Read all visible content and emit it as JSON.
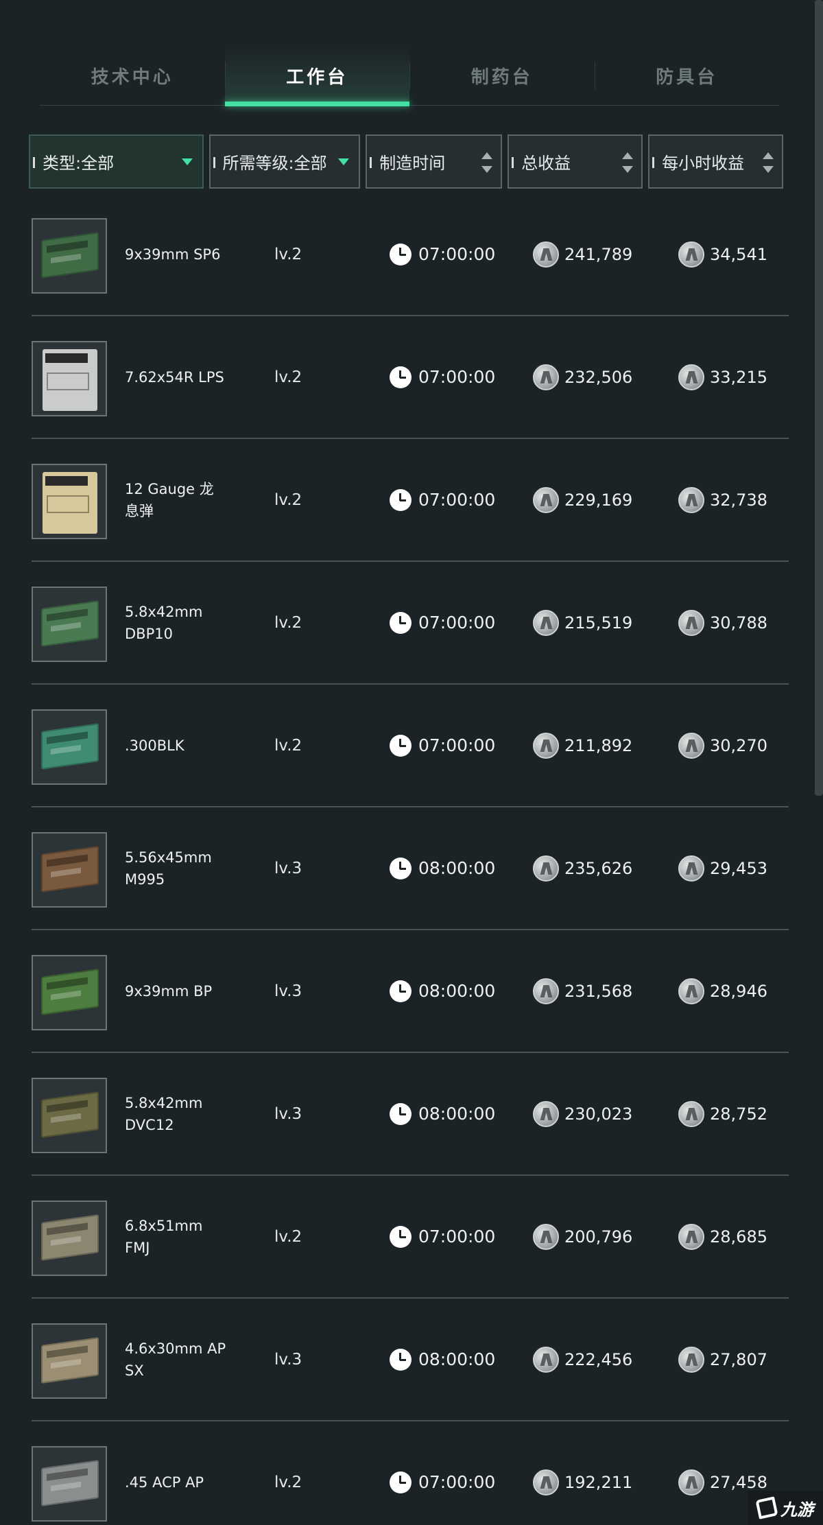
{
  "tabs": [
    {
      "label": "技术中心",
      "active": false
    },
    {
      "label": "工作台",
      "active": true
    },
    {
      "label": "制药台",
      "active": false
    },
    {
      "label": "防具台",
      "active": false
    }
  ],
  "filters": {
    "type": "类型:全部",
    "level": "所需等级:全部",
    "craft_time": "制造时间",
    "total_profit": "总收益",
    "hourly_profit": "每小时收益"
  },
  "items": [
    {
      "name": "9x39mm SP6",
      "level": "lv.2",
      "time": "07:00:00",
      "total": "241,789",
      "hourly": "34,541",
      "color": "#3f6b45"
    },
    {
      "name": "7.62x54R LPS",
      "level": "lv.2",
      "time": "07:00:00",
      "total": "232,506",
      "hourly": "33,215",
      "color": "#c9cccb"
    },
    {
      "name": "12 Gauge 龙息弹",
      "level": "lv.2",
      "time": "07:00:00",
      "total": "229,169",
      "hourly": "32,738",
      "color": "#d6c89a"
    },
    {
      "name": "5.8x42mm DBP10",
      "level": "lv.2",
      "time": "07:00:00",
      "total": "215,519",
      "hourly": "30,788",
      "color": "#4a7a52"
    },
    {
      "name": ".300BLK",
      "level": "lv.2",
      "time": "07:00:00",
      "total": "211,892",
      "hourly": "30,270",
      "color": "#3f8c72"
    },
    {
      "name": "5.56x45mm M995",
      "level": "lv.3",
      "time": "08:00:00",
      "total": "235,626",
      "hourly": "29,453",
      "color": "#7a5a3e"
    },
    {
      "name": "9x39mm BP",
      "level": "lv.3",
      "time": "08:00:00",
      "total": "231,568",
      "hourly": "28,946",
      "color": "#4d7d3f"
    },
    {
      "name": "5.8x42mm DVC12",
      "level": "lv.3",
      "time": "08:00:00",
      "total": "230,023",
      "hourly": "28,752",
      "color": "#6b6a45"
    },
    {
      "name": "6.8x51mm FMJ",
      "level": "lv.2",
      "time": "07:00:00",
      "total": "200,796",
      "hourly": "28,685",
      "color": "#8a8670"
    },
    {
      "name": "4.6x30mm AP SX",
      "level": "lv.3",
      "time": "08:00:00",
      "total": "222,456",
      "hourly": "27,807",
      "color": "#9a8f72"
    },
    {
      "name": ".45 ACP AP",
      "level": "lv.2",
      "time": "07:00:00",
      "total": "192,211",
      "hourly": "27,458",
      "color": "#8a8e8e"
    }
  ],
  "watermark": "九游"
}
